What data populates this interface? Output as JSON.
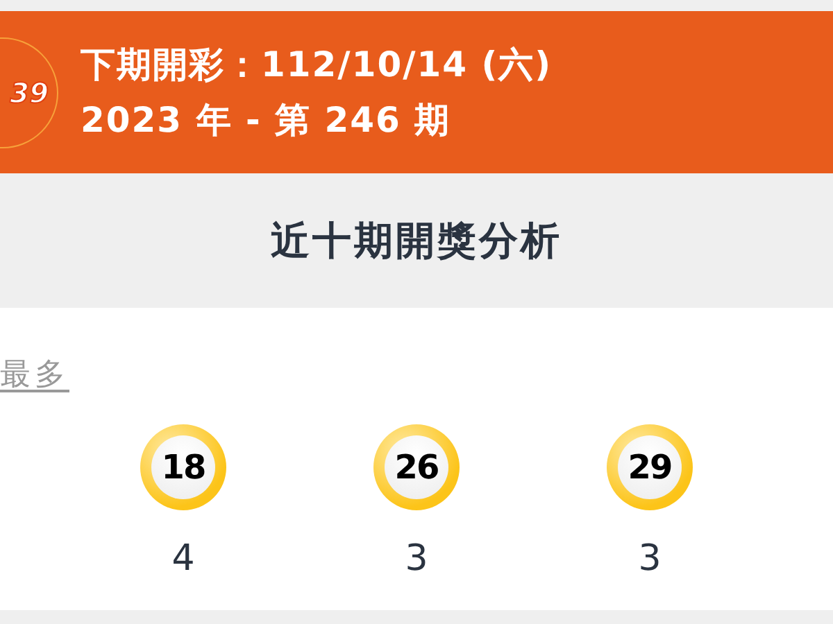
{
  "header": {
    "logo_text": "39",
    "next_draw": "下期開彩：112/10/14 (六)",
    "period": "2023 年 - 第 246 期"
  },
  "section": {
    "title": "近十期開獎分析"
  },
  "most": {
    "link": "最多",
    "balls": [
      {
        "number": "18",
        "count": "4"
      },
      {
        "number": "26",
        "count": "3"
      },
      {
        "number": "29",
        "count": "3"
      }
    ]
  }
}
